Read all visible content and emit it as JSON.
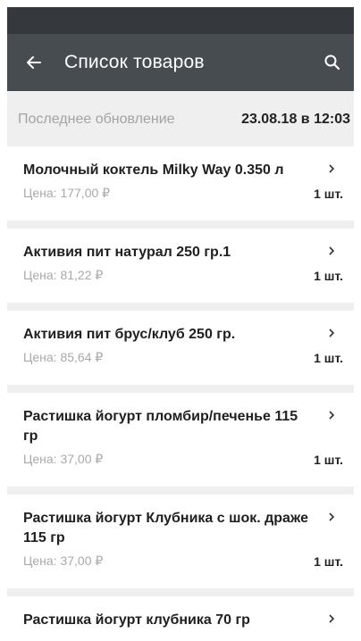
{
  "appbar": {
    "title": "Список товаров",
    "back_icon": "arrow-left-icon",
    "search_icon": "search-icon"
  },
  "update": {
    "label": "Последнее обновление",
    "value": "23.08.18 в 12:03"
  },
  "products": [
    {
      "name": "Молочный коктель Milky Way 0.350 л",
      "price": "Цена: 177,00 ₽",
      "qty": "1 шт."
    },
    {
      "name": "Активия пит натурал 250 гр.1",
      "price": "Цена: 81,22 ₽",
      "qty": "1 шт."
    },
    {
      "name": "Активия пит брус/клуб 250 гр.",
      "price": "Цена: 85,64 ₽",
      "qty": "1 шт."
    },
    {
      "name": "Растишка йогурт пломбир/печенье 115 гр",
      "price": "Цена: 37,00 ₽",
      "qty": "1 шт."
    },
    {
      "name": "Растишка йогурт Клубника с шок. драже 115 гр",
      "price": "Цена: 37,00 ₽",
      "qty": "1 шт."
    },
    {
      "name": "Растишка йогурт клубника 70 гр",
      "price": "",
      "qty": ""
    }
  ],
  "colors": {
    "statusbar": "#35393d",
    "appbar": "#474c51",
    "background": "#efefef"
  }
}
